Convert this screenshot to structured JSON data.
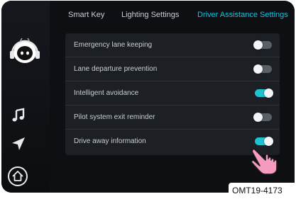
{
  "tabs": [
    {
      "label": "Smart Key",
      "active": false
    },
    {
      "label": "Lighting Settings",
      "active": false
    },
    {
      "label": "Driver Assistance Settings",
      "active": true
    }
  ],
  "settings": [
    {
      "label": "Emergency lane keeping",
      "state": "off"
    },
    {
      "label": "Lane departure prevention",
      "state": "off"
    },
    {
      "label": "Intelligent avoidance",
      "state": "on"
    },
    {
      "label": "Pilot system exit reminder",
      "state": "off"
    },
    {
      "label": "Drive away information",
      "state": "on"
    }
  ],
  "sidebar": {
    "icons": [
      "assistant-avatar-icon",
      "music-note-icon",
      "navigation-arrow-icon",
      "home-icon"
    ]
  },
  "colors": {
    "accent": "#19c1e2",
    "toggle_on": "#1fc2cf",
    "toggle_off": "#5b6068",
    "pointer": "#f59bc0"
  },
  "image_code": "OMT19-4173"
}
